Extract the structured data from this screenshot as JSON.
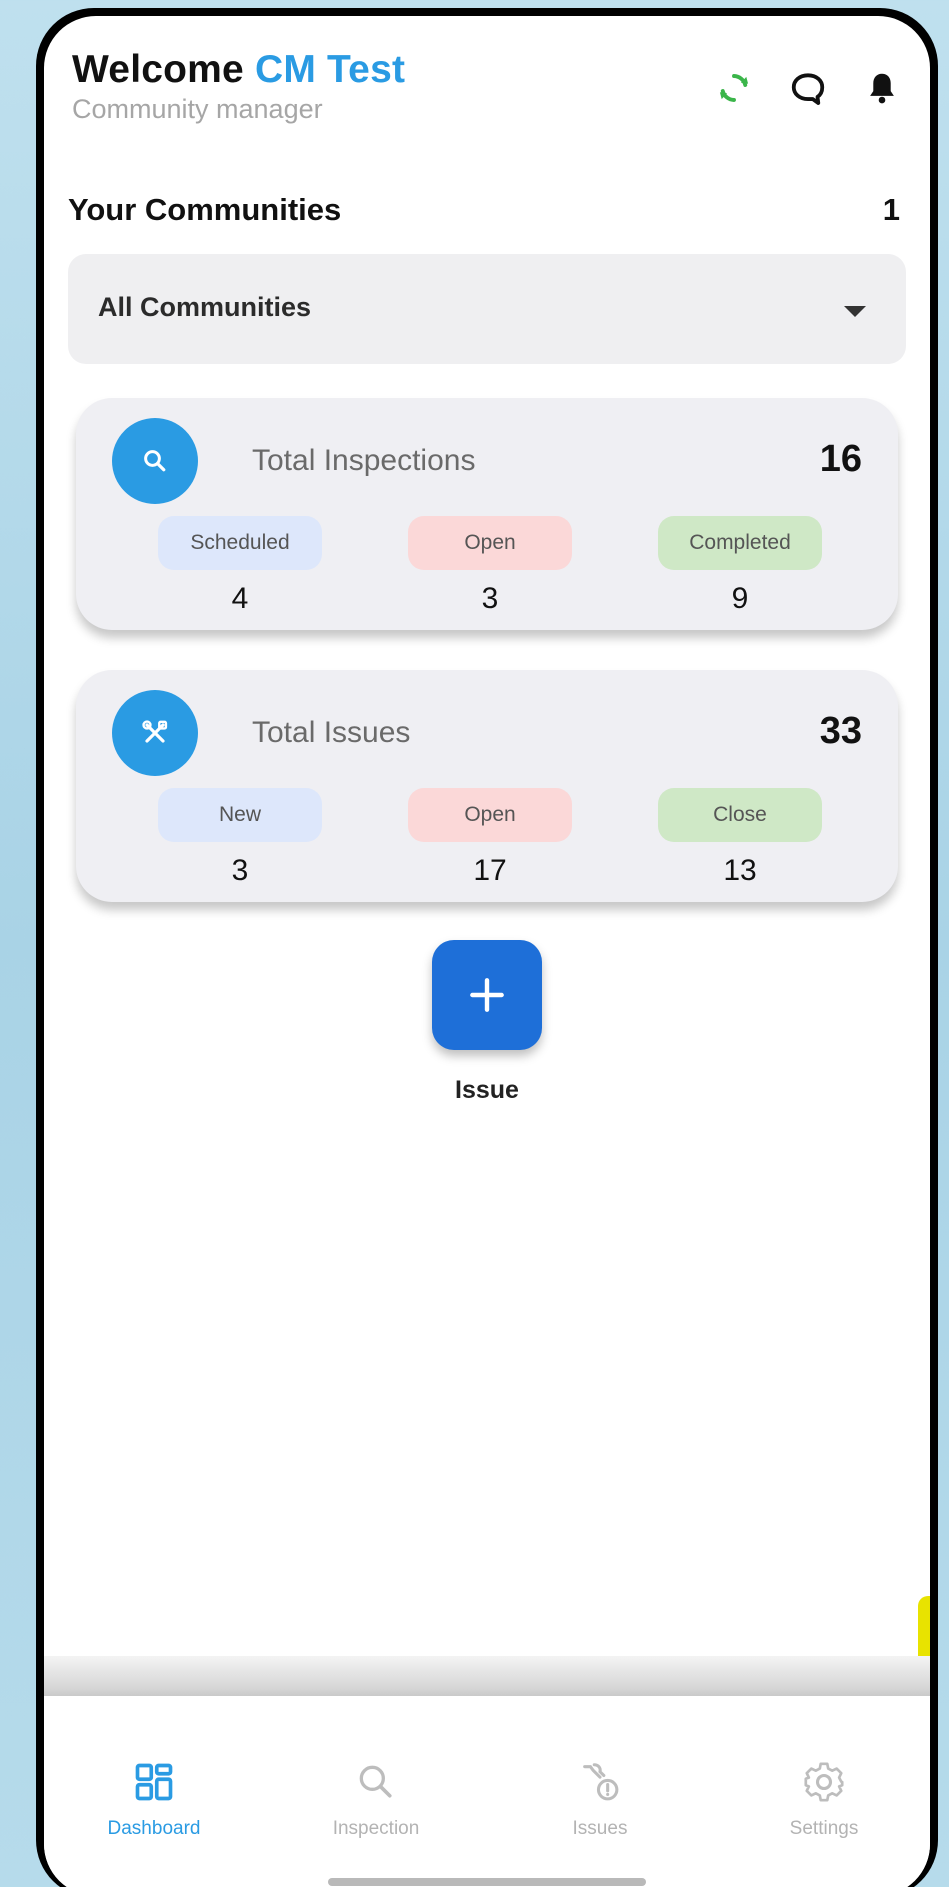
{
  "header": {
    "welcome_prefix": "Welcome",
    "user_name": "CM Test",
    "role": "Community manager",
    "icons": [
      "sync-icon",
      "chat-icon",
      "bell-icon"
    ]
  },
  "communities": {
    "title": "Your Communities",
    "count": "1",
    "dropdown_value": "All Communities"
  },
  "inspections": {
    "title": "Total Inspections",
    "total": "16",
    "icon": "search-icon",
    "stats": [
      {
        "label": "Scheduled",
        "value": "4"
      },
      {
        "label": "Open",
        "value": "3"
      },
      {
        "label": "Completed",
        "value": "9"
      }
    ]
  },
  "issues": {
    "title": "Total Issues",
    "total": "33",
    "icon": "tools-icon",
    "stats": [
      {
        "label": "New",
        "value": "3"
      },
      {
        "label": "Open",
        "value": "17"
      },
      {
        "label": "Close",
        "value": "13"
      }
    ]
  },
  "fab": {
    "label": "Issue",
    "icon": "plus-icon"
  },
  "nav": {
    "items": [
      {
        "label": "Dashboard",
        "icon": "dashboard-icon",
        "active": true
      },
      {
        "label": "Inspection",
        "icon": "search-icon",
        "active": false
      },
      {
        "label": "Issues",
        "icon": "wrench-alert-icon",
        "active": false
      },
      {
        "label": "Settings",
        "icon": "gear-icon",
        "active": false
      }
    ]
  },
  "colors": {
    "accent": "#2a9be3",
    "fab": "#1e6fd8",
    "sync_icon": "#3bb54a",
    "pill_blue": "#dde7fb",
    "pill_pink": "#fbd8d8",
    "pill_green": "#cfe8c6"
  }
}
